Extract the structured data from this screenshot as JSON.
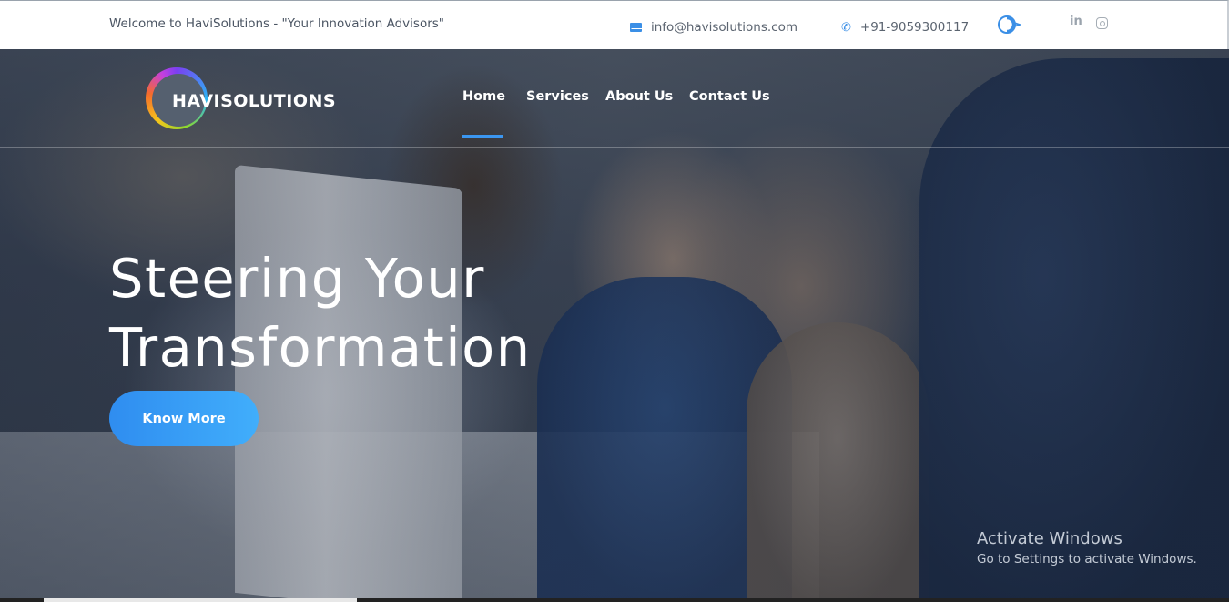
{
  "topbar": {
    "welcome": "Welcome to HaviSolutions - \"Your Innovation Advisors\"",
    "email": "info@havisolutions.com",
    "phone": "+91-9059300117",
    "social": {
      "linkedin_label": "in",
      "instagram_icon": "instagram-icon"
    }
  },
  "header": {
    "logo_text": "HAVISOLUTIONS",
    "nav": [
      {
        "label": "Home",
        "active": true
      },
      {
        "label": "Services",
        "active": false
      },
      {
        "label": "About Us",
        "active": false
      },
      {
        "label": "Contact Us",
        "active": false
      }
    ]
  },
  "hero": {
    "headline_line1": "Steering Your",
    "headline_line2": "Transformation",
    "cta_label": "Know More"
  },
  "watermark": {
    "title": "Activate Windows",
    "subtitle": "Go to Settings to activate Windows."
  },
  "colors": {
    "accent": "#3b96f0",
    "topbar_bg": "#ffffff",
    "cta_start": "#2f8df0",
    "cta_end": "#41aefb"
  }
}
